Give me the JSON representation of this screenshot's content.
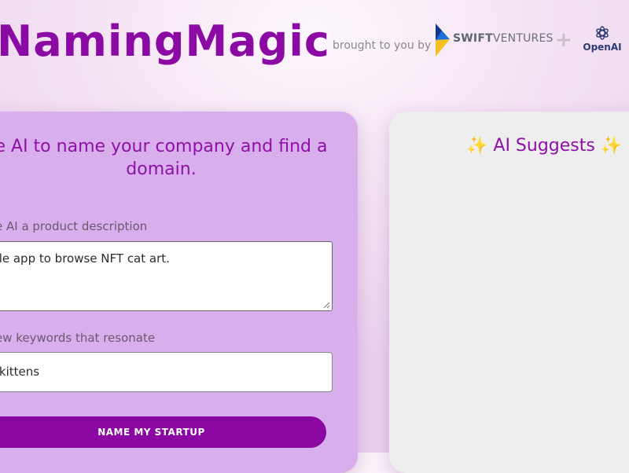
{
  "header": {
    "title": "NamingMagic",
    "brought_by": "brought to you by",
    "sponsor_1_bold": "SWIFT",
    "sponsor_1_rest": "VENTURES",
    "separator": "+",
    "sponsor_2": "OpenAI"
  },
  "form": {
    "heading_line_1": "e AI to name your company and find a",
    "heading_line_2": "domain.",
    "description_label": "e AI a product description",
    "description_value": "bile app to browse NFT cat art.",
    "keywords_label": "ew keywords that resonate",
    "keywords_value": "T kittens",
    "submit_label": "NAME MY STARTUP"
  },
  "results": {
    "sparkle_left": "✨",
    "title": " AI Suggests ",
    "sparkle_right": "✨"
  },
  "colors": {
    "brand_purple": "#8a0aa3",
    "card_lavender": "#d9aeed",
    "results_bg": "#eeeeee"
  },
  "icons": {
    "swift_logo": "swift-ventures-logo-icon",
    "openai_logo": "openai-logo-icon",
    "resize_grip": "resize-grip-icon"
  }
}
